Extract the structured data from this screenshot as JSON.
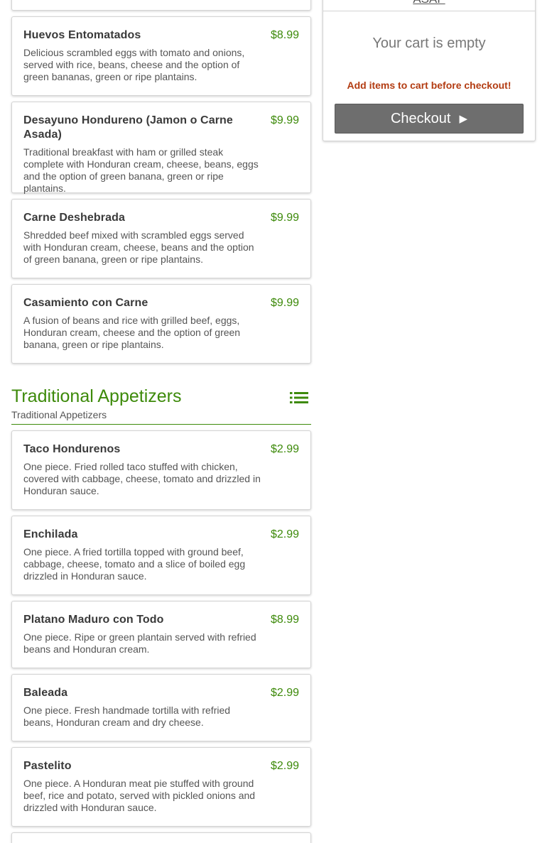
{
  "menu": {
    "items_top": [
      {
        "name": "Huevos Entomatados",
        "price": "$8.99",
        "description": "Delicious scrambled eggs with tomato and onions, served with rice, beans, cheese and the option of green bananas, green or ripe plantains."
      },
      {
        "name": "Desayuno Hondureno (Jamon o Carne Asada)",
        "price": "$9.99",
        "description": "Traditional breakfast with ham or grilled steak complete with Honduran cream, cheese, beans, eggs and the option of green banana, green or ripe plantains."
      },
      {
        "name": "Carne Deshebrada",
        "price": "$9.99",
        "description": "Shredded beef mixed with scrambled eggs served with Honduran cream, cheese, beans and the option of green banana, green or ripe plantains."
      },
      {
        "name": "Casamiento con Carne",
        "price": "$9.99",
        "description": "A fusion of beans and rice with grilled beef, eggs, Honduran cream, cheese and the option of green banana, green or ripe plantains."
      }
    ],
    "section": {
      "title": "Traditional Appetizers",
      "subtitle": "Traditional Appetizers",
      "icon": "list-icon"
    },
    "items_appetizers": [
      {
        "name": "Taco Hondurenos",
        "price": "$2.99",
        "description": "One piece. Fried rolled taco stuffed with chicken, covered with cabbage, cheese, tomato and drizzled in Honduran sauce."
      },
      {
        "name": "Enchilada",
        "price": "$2.99",
        "description": "One piece. A fried tortilla topped with ground beef, cabbage, cheese, tomato and a slice of boiled egg drizzled in Honduran sauce."
      },
      {
        "name": "Platano Maduro con Todo",
        "price": "$8.99",
        "description": "One piece. Ripe or green plantain served with refried beans and Honduran cream."
      },
      {
        "name": "Baleada",
        "price": "$2.99",
        "description": "One piece. Fresh handmade tortilla with refried beans, Honduran cream and dry cheese."
      },
      {
        "name": "Pastelito",
        "price": "$2.99",
        "description": "One piece. A Honduran meat pie stuffed with ground beef, rice and potato, served with pickled onions and drizzled with Honduran sauce."
      }
    ]
  },
  "cart": {
    "timing": "ASAP",
    "empty_text": "Your cart is empty",
    "warning": "Add items to cart before checkout!",
    "checkout_label": "Checkout",
    "checkout_icon": "play-arrow-icon"
  },
  "colors": {
    "accent_green": "#3d8a0a",
    "warning_red": "#b33c12",
    "checkout_gray": "#6e6e6e"
  }
}
